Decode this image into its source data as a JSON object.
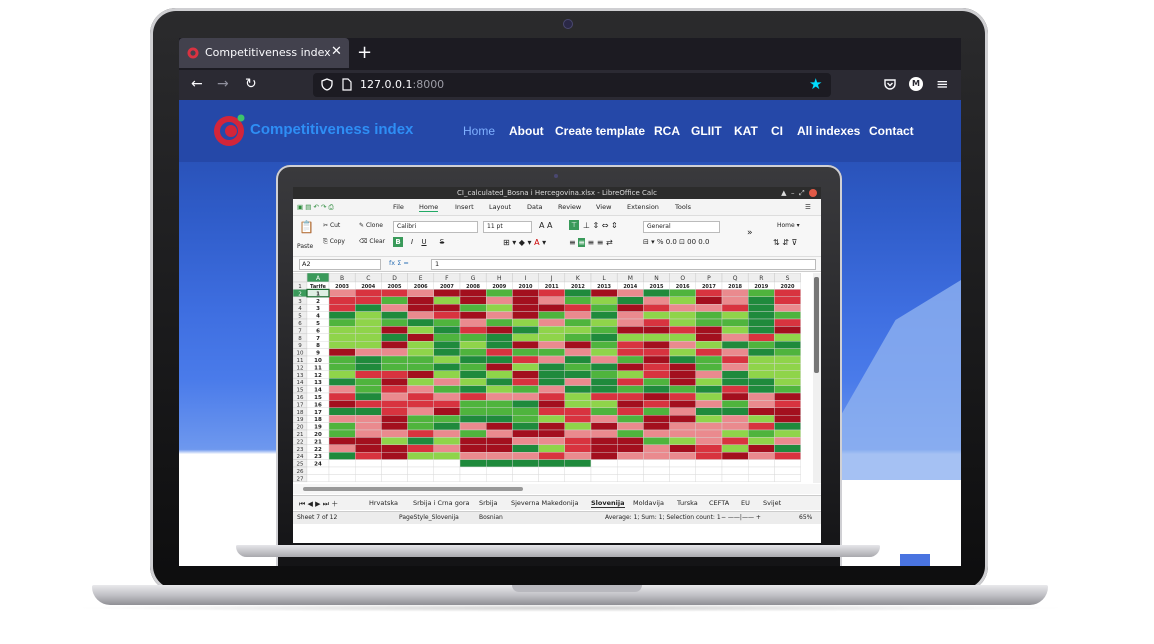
{
  "browser": {
    "tab_title": "Competitiveness index",
    "tab_close": "✕",
    "new_tab": "+",
    "url_host": "127.0.0.1",
    "url_port": ":8000",
    "nav_back": "←",
    "nav_forward": "→",
    "nav_reload": "↻",
    "star": "★",
    "profile_initial": "M",
    "menu": "≡"
  },
  "site": {
    "brand": "Competitiveness index",
    "nav": [
      "Home",
      "About",
      "Create template",
      "RCA",
      "GLIIT",
      "KAT",
      "CI",
      "All indexes",
      "Contact"
    ],
    "colors": {
      "header": "#2548a8",
      "brand": "#2e8ef5",
      "active": "#7fb0ff"
    }
  },
  "calc": {
    "window_title": "CI_calculated_Bosna i Hercegovina.xlsx - LibreOffice Calc",
    "menu": [
      "File",
      "Home",
      "Insert",
      "Layout",
      "Data",
      "Review",
      "View",
      "Extension",
      "Tools"
    ],
    "ribbon": {
      "paste": "Paste",
      "cut": "Cut",
      "copy": "Copy",
      "clone": "Clone",
      "clear": "Clear",
      "font": "Calibri",
      "size": "11 pt",
      "number_format": "General",
      "style": "Home",
      "bold": "B",
      "italic": "I",
      "underline": "U",
      "strike": "S"
    },
    "name_box": "A2",
    "formula_icons": "fx Σ =",
    "formula": "1",
    "columns": [
      "A",
      "B",
      "C",
      "D",
      "E",
      "F",
      "G",
      "H",
      "I",
      "J",
      "K",
      "L",
      "M",
      "N",
      "O",
      "P",
      "Q",
      "R",
      "S"
    ],
    "header_row": [
      "Tarife",
      "2003",
      "2004",
      "2005",
      "2006",
      "2007",
      "2008",
      "2009",
      "2010",
      "2011",
      "2012",
      "2013",
      "2014",
      "2015",
      "2016",
      "2017",
      "2018",
      "2019",
      "2020"
    ],
    "row_count": 27,
    "tarife": [
      "1",
      "2",
      "3",
      "4",
      "5",
      "6",
      "7",
      "8",
      "9",
      "10",
      "11",
      "12",
      "13",
      "14",
      "15",
      "16",
      "17",
      "18",
      "19",
      "20",
      "21",
      "22",
      "23",
      "24"
    ],
    "sheet_tabs": [
      "Hrvatska",
      "Srbija i Crna gora",
      "Srbija",
      "Sjeverna Makedonija",
      "Slovenija",
      "Moldavija",
      "Turska",
      "CEFTA",
      "EU",
      "Svijet"
    ],
    "active_sheet": "Slovenija",
    "status": {
      "sheet": "Sheet 7 of 12",
      "page_style": "PageStyle_Slovenija",
      "language": "Bosnian",
      "summary": "Average: 1; Sum: 1; Selection count: 1",
      "zoom": "65%"
    },
    "colors": {
      "dark_red": "#a30f1e",
      "red": "#d8333f",
      "light_red": "#ea8a8e",
      "light_green": "#8fd44a",
      "green": "#4fb43d",
      "dark_green": "#1f8a3c"
    }
  }
}
